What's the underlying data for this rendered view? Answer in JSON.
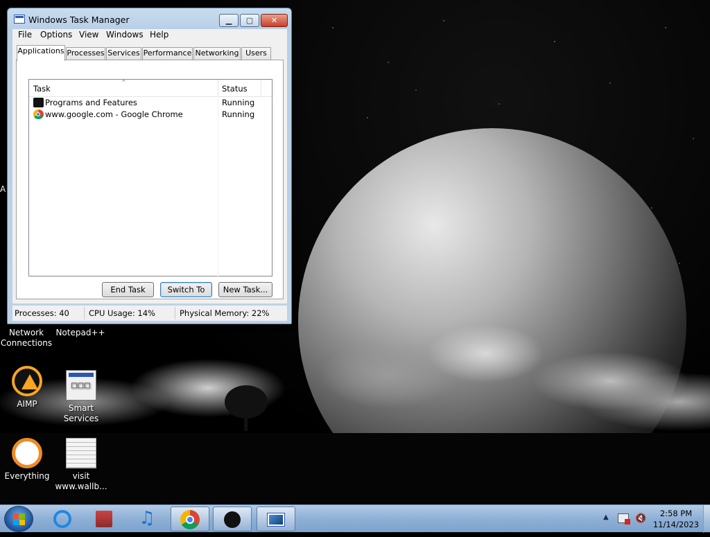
{
  "window": {
    "title": "Windows Task Manager",
    "controls": {
      "minimize": "▁",
      "maximize": "▢",
      "close": "✕"
    }
  },
  "menu": [
    "File",
    "Options",
    "View",
    "Windows",
    "Help"
  ],
  "tabs": [
    "Applications",
    "Processes",
    "Services",
    "Performance",
    "Networking",
    "Users"
  ],
  "active_tab": "Applications",
  "list": {
    "headers": {
      "task": "Task",
      "status": "Status",
      "sort_indicator": "^"
    },
    "rows": [
      {
        "task": "Programs and Features",
        "status": "Running",
        "icon": "programs-features-icon"
      },
      {
        "task": "www.google.com - Google Chrome",
        "status": "Running",
        "icon": "chrome-icon"
      }
    ]
  },
  "buttons": {
    "end_task": "End Task",
    "switch_to": "Switch To",
    "new_task": "New Task..."
  },
  "status_bar": {
    "processes": "Processes: 40",
    "cpu": "CPU Usage: 14%",
    "memory": "Physical Memory: 22%"
  },
  "desktop": {
    "edge_letter": "A",
    "icons": [
      {
        "label": "Network Connections",
        "icon": "network-icon"
      },
      {
        "label": "Notepad++",
        "icon": "notepad-plus-icon"
      },
      {
        "label": "AIMP",
        "icon": "aimp-icon"
      },
      {
        "label": "Smart Services",
        "icon": "smart-services-icon"
      },
      {
        "label": "Everything",
        "icon": "everything-icon"
      },
      {
        "label": "visit www.wallb...",
        "icon": "text-document-icon"
      }
    ]
  },
  "taskbar": {
    "pinned": [
      {
        "name": "internet-explorer",
        "icon": "ie-icon"
      },
      {
        "name": "winrar",
        "icon": "archive-icon"
      },
      {
        "name": "itunes",
        "icon": "music-note-icon"
      },
      {
        "name": "google-chrome",
        "icon": "chrome-icon",
        "open": true
      },
      {
        "name": "programs-and-features",
        "icon": "programs-features-icon",
        "open": true
      },
      {
        "name": "task-manager",
        "icon": "task-manager-icon",
        "open": true
      }
    ],
    "tray": {
      "show_hidden": "▲",
      "volume": "🔇"
    },
    "clock": {
      "time": "2:58 PM",
      "date": "11/14/2023"
    }
  }
}
